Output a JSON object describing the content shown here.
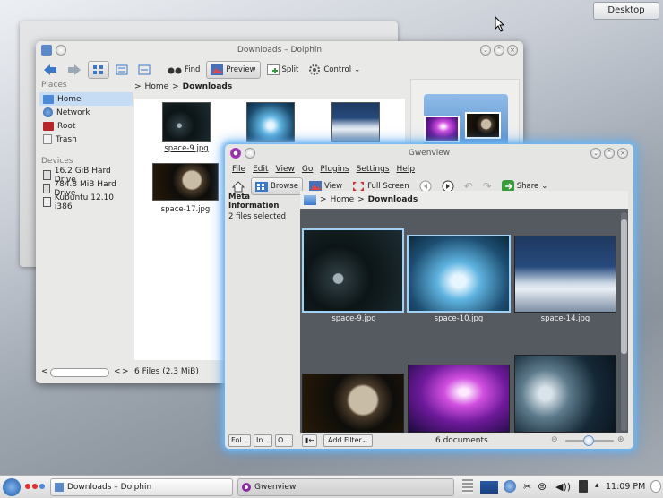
{
  "desktop": {
    "button_label": "Desktop"
  },
  "dolphin": {
    "title": "Downloads – Dolphin",
    "toolbar": {
      "find": "Find",
      "preview": "Preview",
      "split": "Split",
      "control": "Control"
    },
    "places": {
      "heading": "Places",
      "items": [
        {
          "label": "Home",
          "icon": "home-icon",
          "selected": true
        },
        {
          "label": "Network",
          "icon": "network-icon"
        },
        {
          "label": "Root",
          "icon": "root-folder-icon"
        },
        {
          "label": "Trash",
          "icon": "trash-icon"
        }
      ]
    },
    "devices": {
      "heading": "Devices",
      "items": [
        {
          "label": "16.2 GiB Hard Drive",
          "icon": "hard-drive-icon"
        },
        {
          "label": "784.8 MiB Hard Drive",
          "icon": "hard-drive-icon"
        },
        {
          "label": "Kubuntu 12.10 i386",
          "icon": "optical-disc-icon"
        }
      ]
    },
    "breadcrumb": {
      "home": "Home",
      "current": "Downloads"
    },
    "files": [
      {
        "name": "space-9.jpg"
      },
      {
        "name": "space-17.jpg"
      }
    ],
    "status": "6 Files (2.3 MiB)"
  },
  "gwenview": {
    "title": "Gwenview",
    "menu": [
      "File",
      "Edit",
      "View",
      "Go",
      "Plugins",
      "Settings",
      "Help"
    ],
    "toolbar": {
      "browse": "Browse",
      "view": "View",
      "fullscreen": "Full Screen",
      "share": "Share"
    },
    "side": {
      "heading": "Meta Information",
      "sub": "2 files selected"
    },
    "breadcrumb": {
      "home": "Home",
      "current": "Downloads"
    },
    "thumbs": [
      {
        "name": "space-9.jpg",
        "selected": true
      },
      {
        "name": "space-10.jpg",
        "selected": true
      },
      {
        "name": "space-14.jpg",
        "selected": false
      }
    ],
    "status": {
      "add_filter": "Add Filter",
      "count": "6 documents",
      "tab1": "Fol...",
      "tab2": "In...",
      "tab3": "O..."
    }
  },
  "taskbar": {
    "tasks": [
      "Downloads – Dolphin",
      "Gwenview"
    ],
    "clock": "11:09 PM"
  }
}
